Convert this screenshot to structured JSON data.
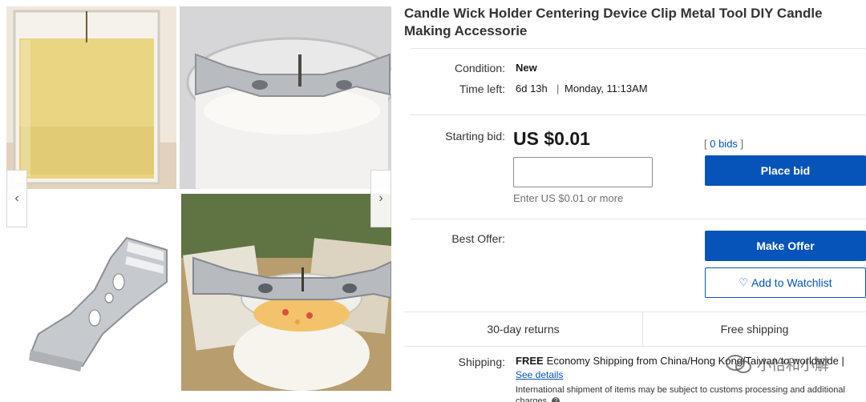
{
  "gallery": {
    "images": [
      {
        "description_icon": "candle-glass-image"
      },
      {
        "description_icon": "wick-holder-on-jar-image"
      },
      {
        "description_icon": "wick-holder-tool-image"
      },
      {
        "description_icon": "candle-with-holder-image"
      }
    ],
    "prev_arrow": "‹",
    "next_arrow": "›"
  },
  "listing": {
    "title": "Candle Wick Holder Centering Device Clip Metal Tool DIY Candle Making Accessorie",
    "condition_label": "Condition:",
    "condition_value": "New",
    "time_left_label": "Time left:",
    "time_left_value": "6d 13h",
    "time_left_separator": "|",
    "end_time": "Monday, 11:13AM",
    "starting_bid_label": "Starting bid:",
    "starting_bid_value": "US $0.01",
    "bid_input_value": "",
    "bid_hint": "Enter US $0.01 or more",
    "bids_open": "[ ",
    "bids_link": "0 bids",
    "bids_close": " ]",
    "place_bid_label": "Place bid",
    "best_offer_label": "Best Offer:",
    "make_offer_label": "Make Offer",
    "watchlist_icon": "♡",
    "watchlist_label": "Add to Watchlist",
    "returns_label": "30-day returns",
    "free_shipping_label": "Free shipping",
    "shipping_label": "Shipping:",
    "shipping_free": "FREE",
    "shipping_text": "Economy Shipping from China/Hong Kong/Taiwan to worldwide |",
    "see_details": "See details",
    "intl_note": "International shipment of items may be subject to customs processing and additional charges.",
    "intl_icon": "?"
  },
  "watermark": {
    "text": "小怡和小解"
  },
  "colors": {
    "accent": "#0654ba",
    "divider": "#e5e5e5"
  }
}
